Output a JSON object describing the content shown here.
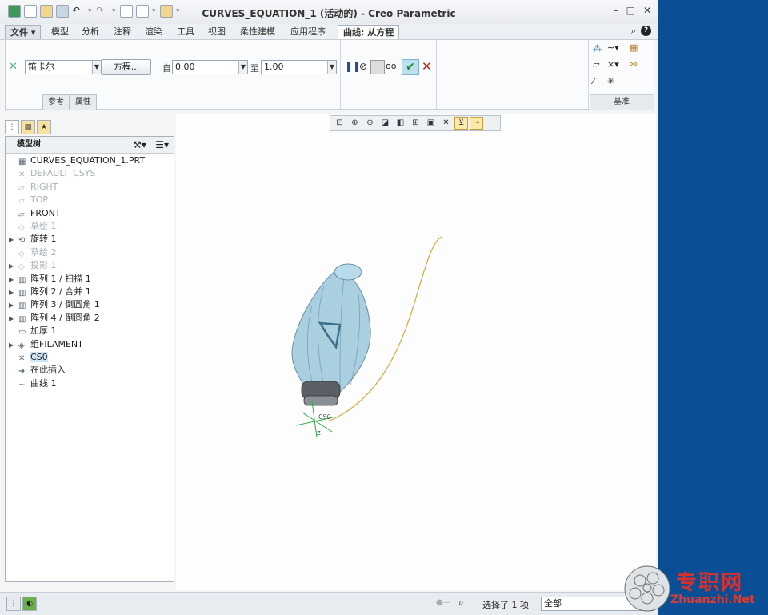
{
  "window": {
    "title": "CURVES_EQUATION_1 (活动的) - Creo Parametric",
    "controls": [
      "–",
      "□",
      "✕"
    ]
  },
  "menu": {
    "file": "文件",
    "tabs": [
      "模型",
      "分析",
      "注释",
      "渲染",
      "工具",
      "视图",
      "柔性建模",
      "应用程序"
    ],
    "active_tab": "曲线: 从方程"
  },
  "ribbon": {
    "coord_system": "笛卡尔",
    "equation_button": "方程...",
    "from_label": "自",
    "from_value": "0.00",
    "to_label": "至",
    "to_value": "1.00",
    "subtabs": [
      "参考",
      "属性"
    ],
    "group_label": "基准"
  },
  "model_tree": {
    "header": "模型树",
    "items": [
      {
        "label": "CURVES_EQUATION_1.PRT",
        "expand": "",
        "state": "normal"
      },
      {
        "label": "DEFAULT_CSYS",
        "expand": "",
        "state": "dim"
      },
      {
        "label": "RIGHT",
        "expand": "",
        "state": "dim"
      },
      {
        "label": "TOP",
        "expand": "",
        "state": "dim"
      },
      {
        "label": "FRONT",
        "expand": "",
        "state": "normal"
      },
      {
        "label": "草绘 1",
        "expand": "",
        "state": "dim"
      },
      {
        "label": "旋转 1",
        "expand": "▶",
        "state": "normal"
      },
      {
        "label": "草绘 2",
        "expand": "",
        "state": "dim"
      },
      {
        "label": "投影 1",
        "expand": "▶",
        "state": "dim"
      },
      {
        "label": "阵列 1 / 扫描 1",
        "expand": "▶",
        "state": "normal"
      },
      {
        "label": "阵列 2 / 合并 1",
        "expand": "▶",
        "state": "normal"
      },
      {
        "label": "阵列 3 / 倒圆角 1",
        "expand": "▶",
        "state": "normal"
      },
      {
        "label": "阵列 4 / 倒圆角 2",
        "expand": "▶",
        "state": "normal"
      },
      {
        "label": "加厚 1",
        "expand": "",
        "state": "normal"
      },
      {
        "label": "组FILAMENT",
        "expand": "▶",
        "state": "normal"
      },
      {
        "label": "CS0",
        "expand": "",
        "state": "selected"
      },
      {
        "label": "在此插入",
        "expand": "",
        "state": "normal"
      },
      {
        "label": "曲线 1",
        "expand": "",
        "state": "normal"
      }
    ]
  },
  "graphics": {
    "csys_label": "CS0",
    "axis_label": "Z",
    "curve_color": "#d4a93a",
    "model_color": "#9cc7da"
  },
  "status": {
    "selection": "选择了 1 项",
    "filter": "全部"
  },
  "watermark": {
    "title": "专职网",
    "site": "Zhuanzhi.Net"
  }
}
